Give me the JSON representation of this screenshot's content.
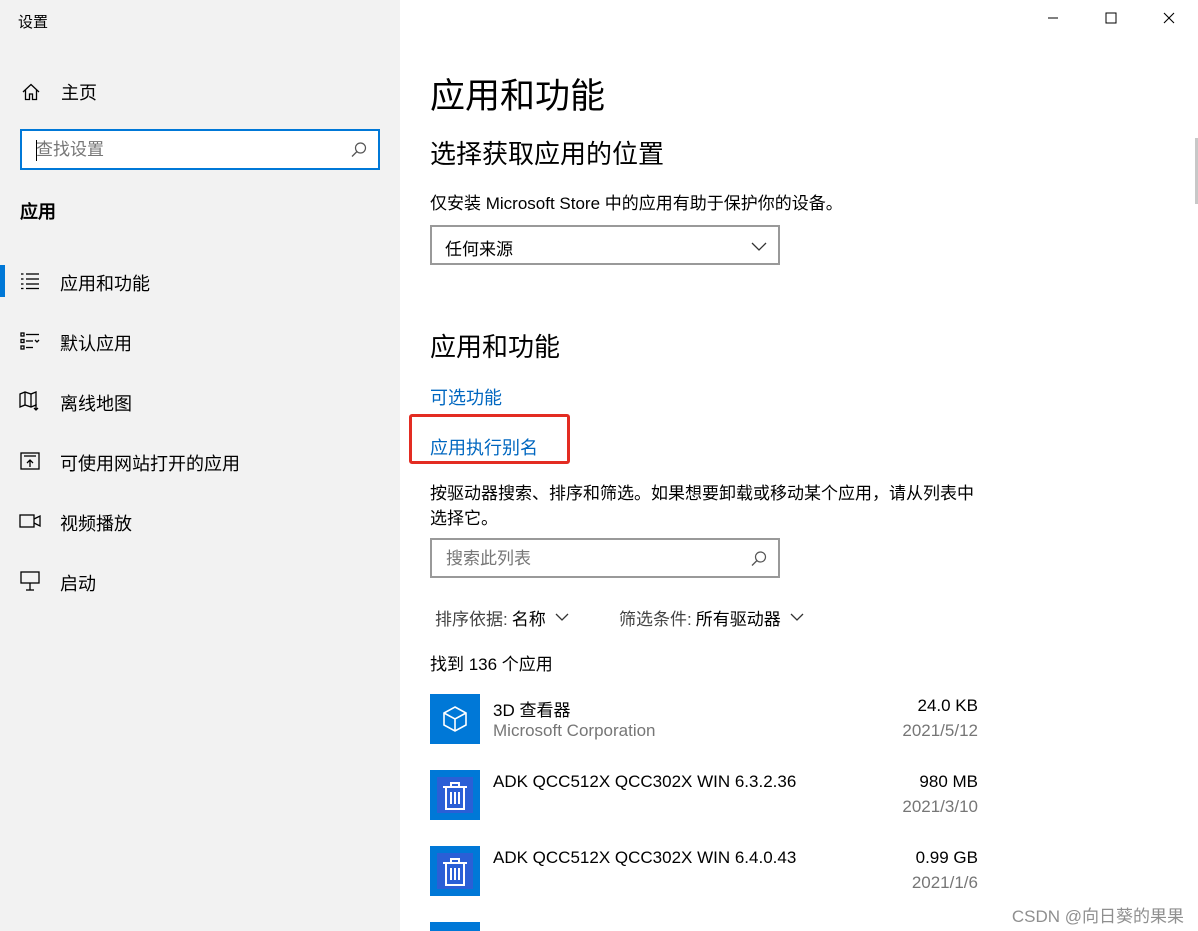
{
  "window": {
    "title": "设置",
    "controls": [
      "minimize-icon",
      "maximize-icon",
      "close-icon"
    ]
  },
  "sidebar": {
    "home_label": "主页",
    "search_placeholder": "查找设置",
    "section_label": "应用",
    "items": [
      {
        "label": "应用和功能",
        "icon": "apps-features-icon",
        "selected": true
      },
      {
        "label": "默认应用",
        "icon": "default-apps-icon",
        "selected": false
      },
      {
        "label": "离线地图",
        "icon": "offline-maps-icon",
        "selected": false
      },
      {
        "label": "可使用网站打开的应用",
        "icon": "apps-for-websites-icon",
        "selected": false
      },
      {
        "label": "视频播放",
        "icon": "video-playback-icon",
        "selected": false
      },
      {
        "label": "启动",
        "icon": "startup-icon",
        "selected": false
      }
    ]
  },
  "main": {
    "page_title": "应用和功能",
    "source_section": {
      "heading": "选择获取应用的位置",
      "description": "仅安装 Microsoft Store 中的应用有助于保护你的设备。",
      "dropdown_value": "任何来源"
    },
    "apps_section": {
      "heading": "应用和功能",
      "optional_features_link": "可选功能",
      "app_aliases_link": "应用执行别名",
      "description_line1": "按驱动器搜索、排序和筛选。如果想要卸载或移动某个应用，请从列表中",
      "description_line2": "选择它。",
      "search_placeholder": "搜索此列表",
      "sort_label": "排序依据:",
      "sort_value": "名称",
      "filter_label": "筛选条件:",
      "filter_value": "所有驱动器",
      "found_text": "找到 136 个应用",
      "apps": [
        {
          "name": "3D 查看器",
          "publisher": "Microsoft Corporation",
          "size": "24.0 KB",
          "date": "2021/5/12",
          "icon": "3d-viewer-icon"
        },
        {
          "name": "ADK QCC512X QCC302X WIN 6.3.2.36",
          "publisher": "",
          "size": "980 MB",
          "date": "2021/3/10",
          "icon": "installer-icon"
        },
        {
          "name": "ADK QCC512X QCC302X WIN 6.4.0.43",
          "publisher": "",
          "size": "0.99 GB",
          "date": "2021/1/6",
          "icon": "installer-icon"
        }
      ]
    }
  },
  "watermark": "CSDN @向日葵的果果",
  "colors": {
    "accent": "#0078d7",
    "link": "#0067c0",
    "highlight": "#e32c22",
    "tile": "#0078d7"
  }
}
